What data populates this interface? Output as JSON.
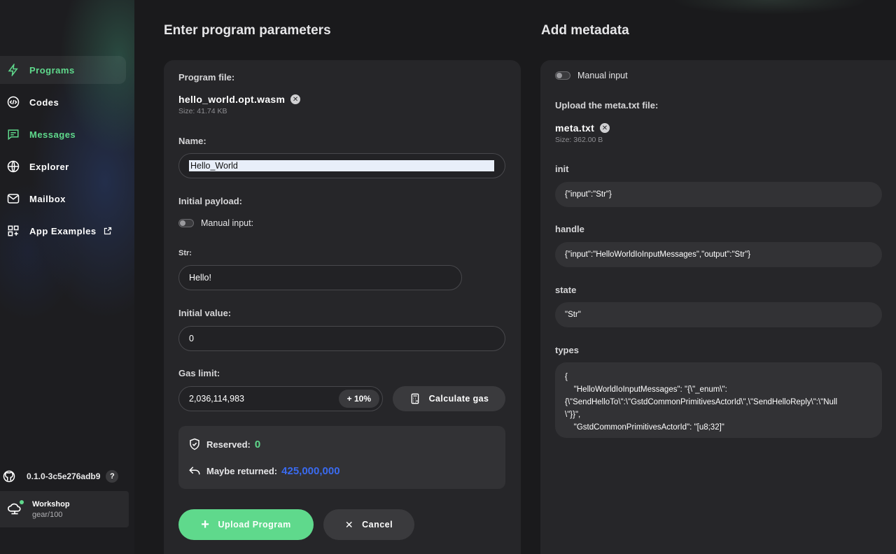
{
  "sidebar": {
    "items": [
      {
        "label": "Programs"
      },
      {
        "label": "Codes"
      },
      {
        "label": "Messages"
      },
      {
        "label": "Explorer"
      },
      {
        "label": "Mailbox"
      },
      {
        "label": "App Examples"
      }
    ],
    "version": "0.1.0-3c5e276adb9",
    "help": "?",
    "node": {
      "name": "Workshop",
      "sub": "gear/100"
    }
  },
  "left": {
    "title": "Enter program parameters",
    "program_file_label": "Program file:",
    "file_name": "hello_world.opt.wasm",
    "file_size": "Size: 41.74 KB",
    "name_label": "Name:",
    "name_value": "Hello_World",
    "payload_label": "Initial payload:",
    "manual_input_label": "Manual input:",
    "str_label": "Str:",
    "str_value": "Hello!",
    "value_label": "Initial value:",
    "value_value": "0",
    "gas_label": "Gas limit:",
    "gas_value": "2,036,114,983",
    "gas_plus": "+ 10%",
    "calc_gas": "Calculate gas",
    "reserved_label": "Reserved:",
    "reserved_value": "0",
    "returned_label": "Maybe returned:",
    "returned_value": "425,000,000",
    "upload_label": "Upload Program",
    "cancel_label": "Cancel"
  },
  "right": {
    "title": "Add metadata",
    "manual_input_label": "Manual input",
    "upload_label": "Upload the meta.txt file:",
    "file_name": "meta.txt",
    "file_size": "Size: 362.00 B",
    "init_label": "init",
    "init_value": "{\"input\":\"Str\"}",
    "handle_label": "handle",
    "handle_value": "{\"input\":\"HelloWorldIoInputMessages\",\"output\":\"Str\"}",
    "state_label": "state",
    "state_value": "\"Str\"",
    "types_label": "types",
    "types_value": "{\n    \"HelloWorldIoInputMessages\": \"{\\\"_enum\\\":\n{\\\"SendHelloTo\\\":\\\"GstdCommonPrimitivesActorId\\\",\\\"SendHelloReply\\\":\\\"Null\n\\\"}}\",\n    \"GstdCommonPrimitivesActorId\": \"[u8;32]\""
  },
  "colors": {
    "accent_green": "#5fd98c",
    "accent_blue": "#3a6bf0",
    "panel": "#262629",
    "background": "#1a1a1c"
  }
}
